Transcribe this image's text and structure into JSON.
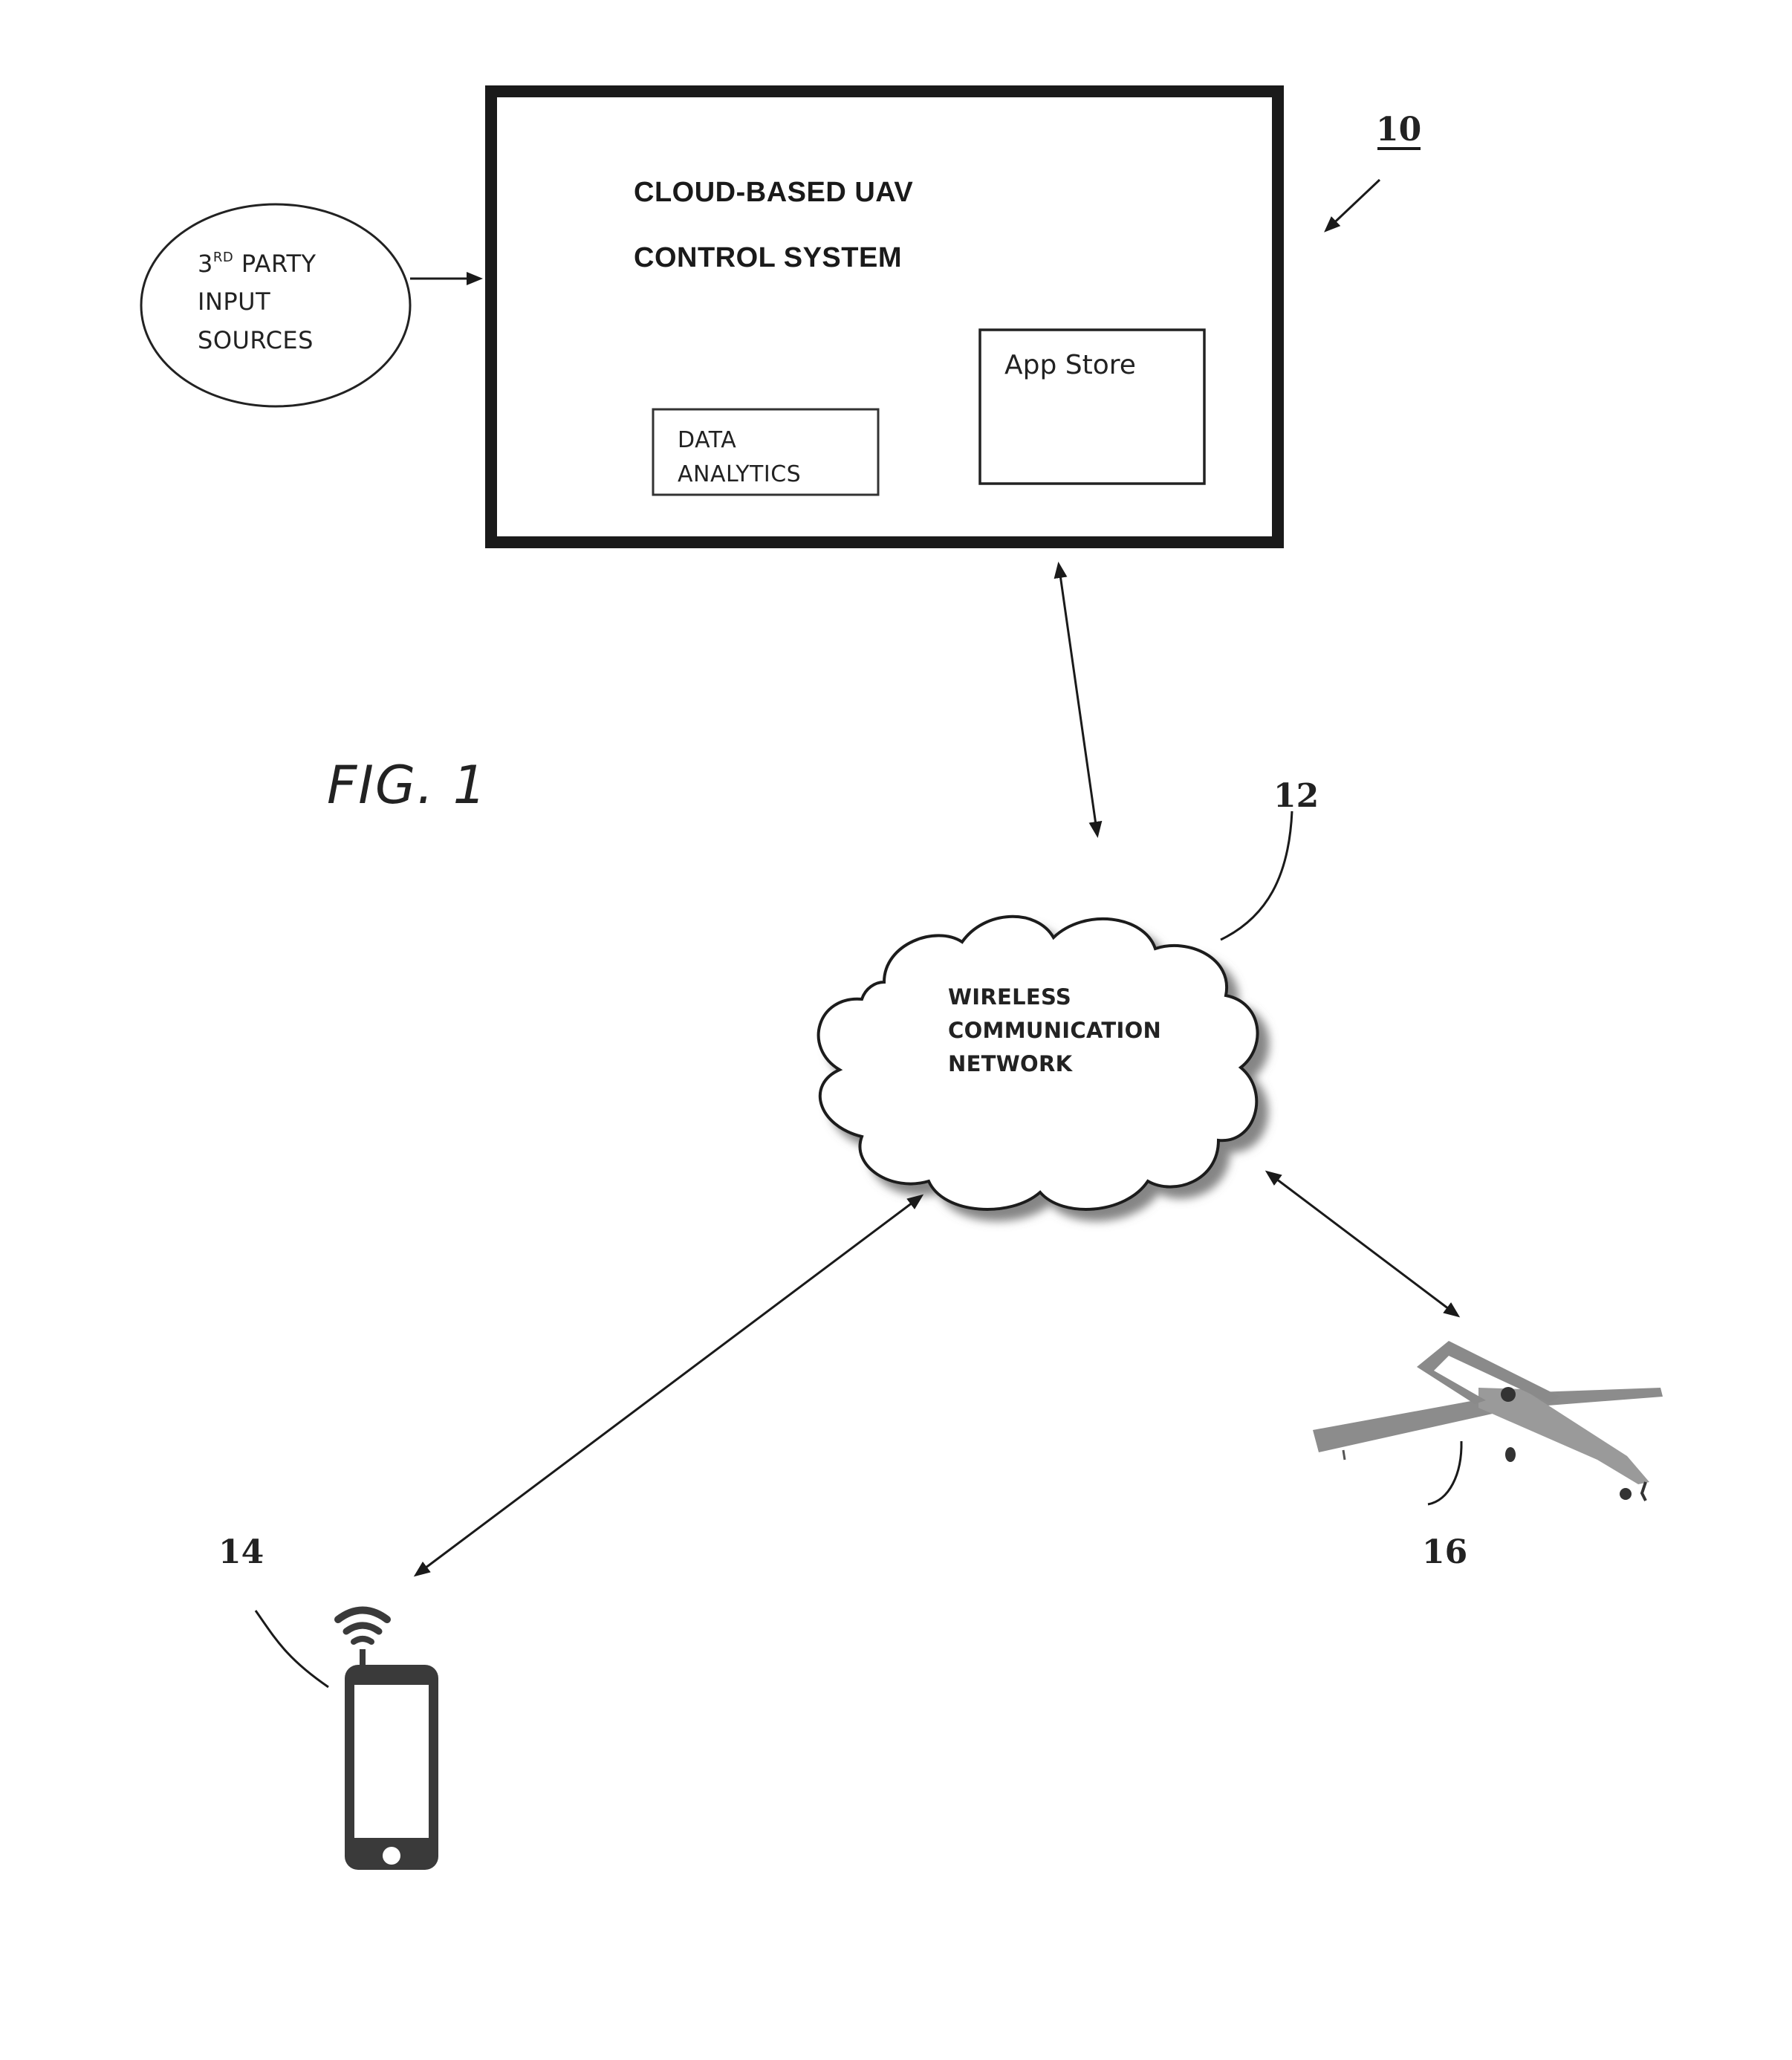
{
  "figure": {
    "label": "FIG. 1",
    "reference_numerals": {
      "system": "10",
      "network": "12",
      "mobile_device": "14",
      "uav": "16"
    }
  },
  "control_system": {
    "title_line1": "CLOUD-BASED UAV",
    "title_line2": "CONTROL SYSTEM",
    "modules": {
      "app_store": "App Store",
      "data_analytics_line1": "DATA",
      "data_analytics_line2": "ANALYTICS"
    }
  },
  "third_party": {
    "ordinal": "3",
    "ordinal_suffix": "RD",
    "line1_rest": "PARTY",
    "line2": "INPUT",
    "line3": "SOURCES"
  },
  "network": {
    "line1": "WIRELESS",
    "line2": "COMMUNICATION",
    "line3": "NETWORK"
  },
  "icons": {
    "mobile_device": "smartphone-with-wifi-icon",
    "uav": "fixed-wing-drone-icon",
    "network": "cloud-icon"
  },
  "colors": {
    "ink": "#1a1a1a",
    "background": "#ffffff",
    "shadow": "#8a8a8a"
  }
}
